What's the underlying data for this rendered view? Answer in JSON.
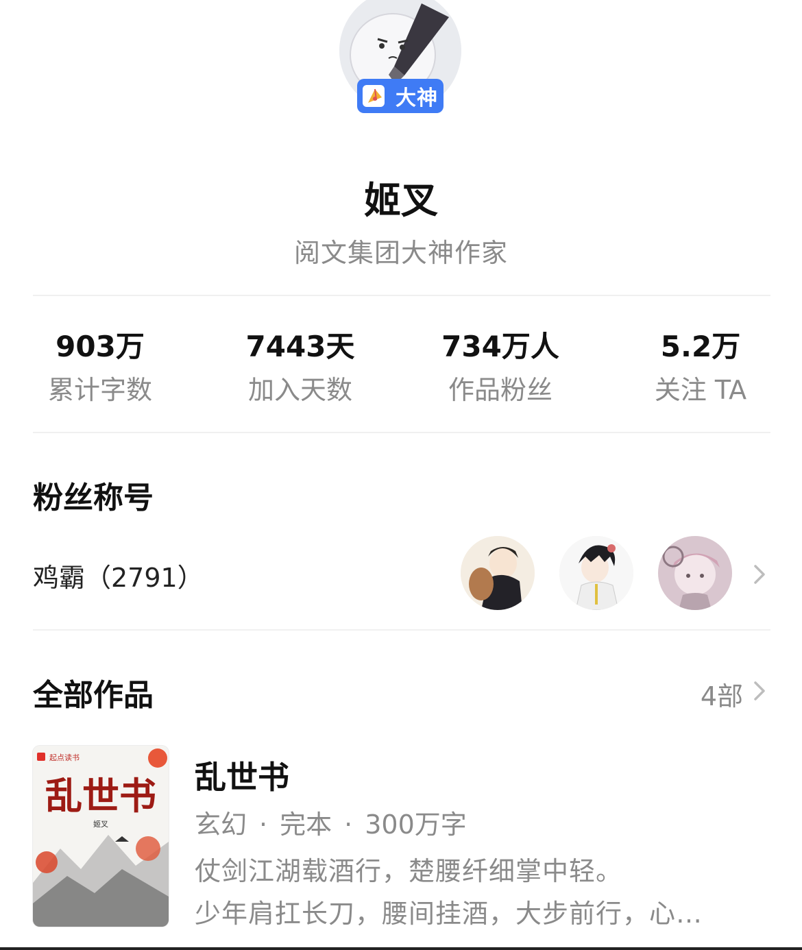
{
  "profile": {
    "badge_label": "大神",
    "name": "姬叉",
    "title": "阅文集团大神作家"
  },
  "stats": [
    {
      "value": "903万",
      "label": "累计字数"
    },
    {
      "value": "7443天",
      "label": "加入天数"
    },
    {
      "value": "734万人",
      "label": "作品粉丝"
    },
    {
      "value": "5.2万",
      "label": "关注 TA"
    }
  ],
  "fan_section": {
    "title": "粉丝称号",
    "fan_name": "鸡霸（2791）"
  },
  "works_section": {
    "title": "全部作品",
    "count": "4部"
  },
  "book": {
    "title": "乱世书",
    "genre": "玄幻",
    "status": "完本",
    "word_count": "300万字",
    "separator": "·",
    "desc_line1": "仗剑江湖载酒行，楚腰纤细掌中轻。",
    "desc_line2": "少年肩扛长刀，腰间挂酒，大步前行，心…",
    "cover": {
      "publisher": "起点读书",
      "title": "乱世书",
      "author": "姬叉"
    }
  },
  "colors": {
    "badge": "#3f7bf5",
    "muted_text": "#8a8a8a",
    "primary_text": "#111111"
  }
}
